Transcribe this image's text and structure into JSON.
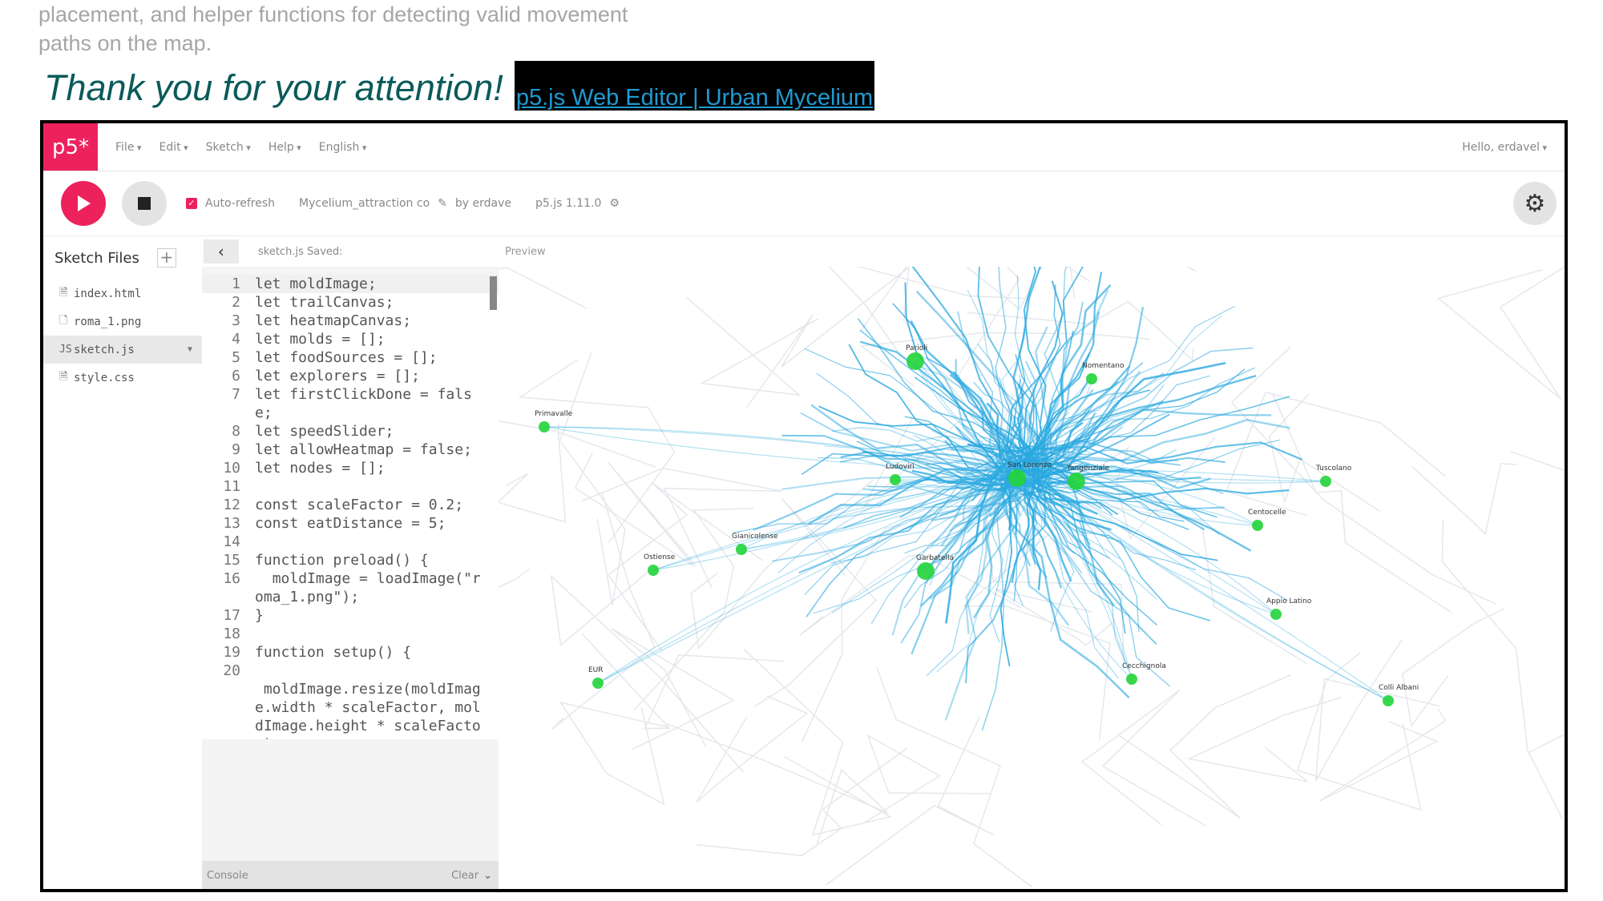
{
  "slide": {
    "intro_line1": "placement, and helper functions for detecting valid movement",
    "intro_line2": "paths on the map.",
    "thanks": "Thank you for your attention!",
    "link": "p5.js Web Editor | Urban Mycelium"
  },
  "menubar": {
    "logo": "p5*",
    "items": [
      "File",
      "Edit",
      "Sketch",
      "Help",
      "English"
    ],
    "user": "Hello, erdavel"
  },
  "toolbar": {
    "auto_refresh": "Auto-refresh",
    "sketch_name": "Mycelium_attraction co",
    "author": "by erdave",
    "version": "p5.js 1.11.0"
  },
  "sidebar": {
    "title": "Sketch Files",
    "files": [
      {
        "name": "index.html",
        "icon": "html-file-icon"
      },
      {
        "name": "roma_1.png",
        "icon": "image-file-icon"
      },
      {
        "name": "sketch.js",
        "icon": "js-file-icon"
      },
      {
        "name": "style.css",
        "icon": "css-file-icon"
      }
    ]
  },
  "editor": {
    "file_status": "sketch.js Saved:",
    "lines": [
      {
        "n": "1",
        "code": "let moldImage;"
      },
      {
        "n": "2",
        "code": "let trailCanvas;"
      },
      {
        "n": "3",
        "code": "let heatmapCanvas;"
      },
      {
        "n": "4",
        "code": "let molds = [];"
      },
      {
        "n": "5",
        "code": "let foodSources = [];"
      },
      {
        "n": "6",
        "code": "let explorers = [];"
      },
      {
        "n": "7",
        "code": "let firstClickDone = false;"
      },
      {
        "n": "8",
        "code": "let speedSlider;"
      },
      {
        "n": "9",
        "code": "let allowHeatmap = false;"
      },
      {
        "n": "10",
        "code": "let nodes = [];"
      },
      {
        "n": "11",
        "code": ""
      },
      {
        "n": "12",
        "code": "const scaleFactor = 0.2;"
      },
      {
        "n": "13",
        "code": "const eatDistance = 5;"
      },
      {
        "n": "14",
        "code": ""
      },
      {
        "n": "15",
        "code": "function preload() {"
      },
      {
        "n": "16",
        "code": "  moldImage = loadImage(\"roma_1.png\");"
      },
      {
        "n": "17",
        "code": "}"
      },
      {
        "n": "18",
        "code": ""
      },
      {
        "n": "19",
        "code": "function setup() {"
      },
      {
        "n": "20",
        "code": ""
      },
      {
        "n": "",
        "code": " moldImage.resize(moldImage.width * scaleFactor, moldImage.height * scaleFactor);"
      }
    ]
  },
  "console": {
    "label": "Console",
    "clear": "Clear"
  },
  "preview": {
    "label": "Preview",
    "nodes": [
      {
        "label": "Parioli"
      },
      {
        "label": "Nomentano"
      },
      {
        "label": "Primavalle"
      },
      {
        "label": "Ludoviri"
      },
      {
        "label": "San Lorenzo"
      },
      {
        "label": "Tangenziale"
      },
      {
        "label": "Tuscolano"
      },
      {
        "label": "Centocelle"
      },
      {
        "label": "Gianicolense"
      },
      {
        "label": "Ostiense"
      },
      {
        "label": "Garbatella"
      },
      {
        "label": "Appio Latino"
      },
      {
        "label": "EUR"
      },
      {
        "label": "Cecchignola"
      },
      {
        "label": "Colli Albani"
      }
    ]
  },
  "colors": {
    "accent": "#ed225d",
    "trail": "#29a8e0",
    "node": "#22d43a",
    "link": "#1f9bd1",
    "title": "#0b5a5a"
  }
}
